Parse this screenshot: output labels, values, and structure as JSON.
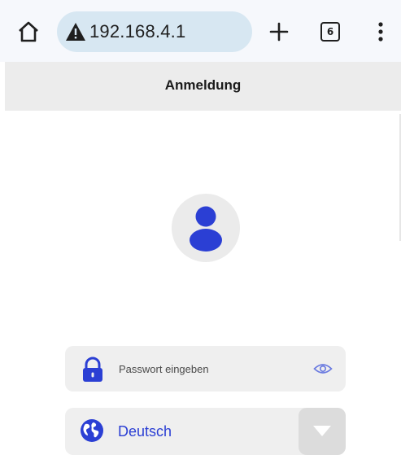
{
  "browser": {
    "url": "192.168.4.1",
    "tab_count": "6",
    "icons": [
      "home-icon",
      "not-secure-warning-icon",
      "plus-icon",
      "tab-switcher-icon",
      "more-vert-icon"
    ]
  },
  "page": {
    "title": "Anmeldung"
  },
  "login": {
    "avatar_icon": "user-icon",
    "password": {
      "value": "",
      "placeholder": "Passwort eingeben",
      "icons": [
        "lock-icon",
        "eye-icon"
      ]
    },
    "language": {
      "selected": "Deutsch",
      "icons": [
        "globe-icon",
        "chevron-down-icon"
      ]
    }
  },
  "colors": {
    "accent": "#2b3fd4",
    "url_pill": "#d7e7f2",
    "header_bg": "#ececec",
    "field_bg": "#efefef"
  }
}
